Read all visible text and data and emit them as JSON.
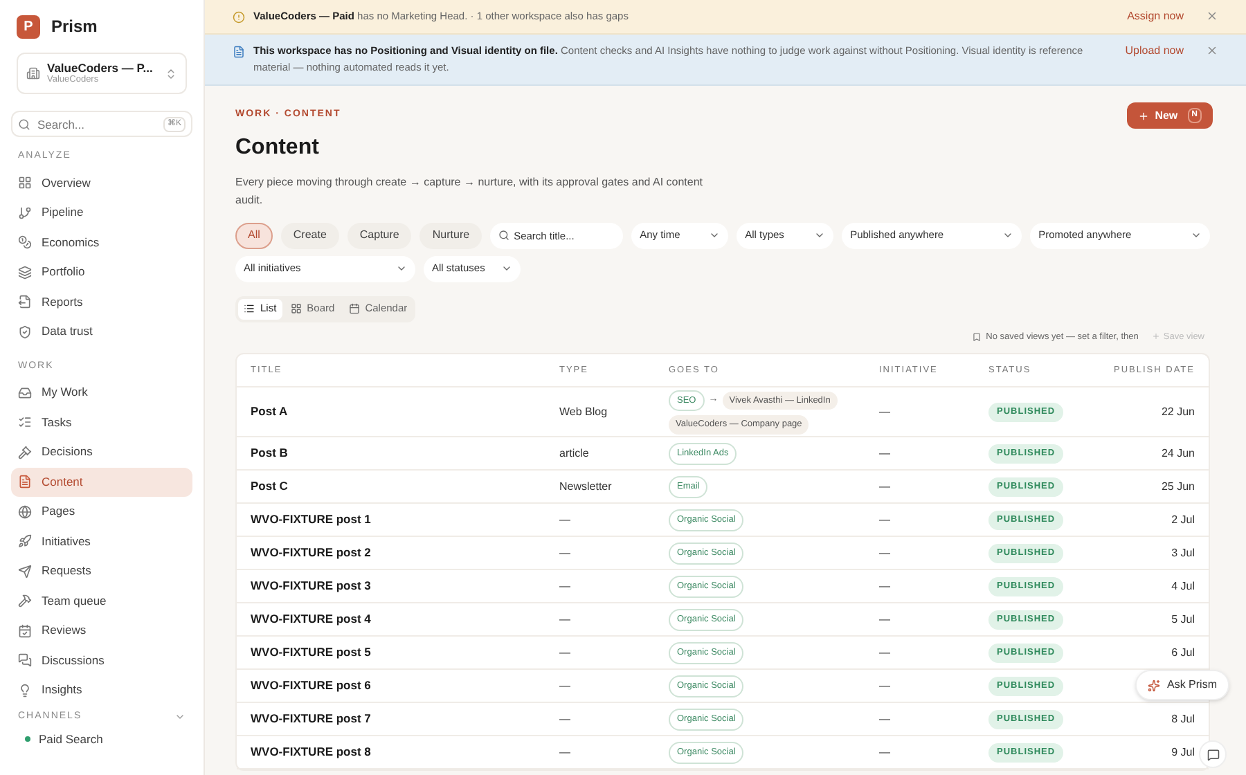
{
  "app": {
    "name": "Prism",
    "logo_letter": "P"
  },
  "workspace": {
    "name": "ValueCoders — P...",
    "sub": "ValueCoders"
  },
  "search": {
    "placeholder": "Search...",
    "shortcut": "⌘K"
  },
  "sections": [
    {
      "title": "ANALYZE",
      "items": [
        {
          "label": "Overview",
          "selected": false
        },
        {
          "label": "Pipeline",
          "selected": false
        },
        {
          "label": "Economics",
          "selected": false
        },
        {
          "label": "Portfolio",
          "selected": false
        },
        {
          "label": "Reports",
          "selected": false
        },
        {
          "label": "Data trust",
          "selected": false
        }
      ]
    },
    {
      "title": "WORK",
      "items": [
        {
          "label": "My Work",
          "selected": false
        },
        {
          "label": "Tasks",
          "selected": false
        },
        {
          "label": "Decisions",
          "selected": false
        },
        {
          "label": "Content",
          "selected": true
        },
        {
          "label": "Pages",
          "selected": false
        },
        {
          "label": "Initiatives",
          "selected": false
        },
        {
          "label": "Requests",
          "selected": false
        },
        {
          "label": "Team queue",
          "selected": false
        },
        {
          "label": "Reviews",
          "selected": false
        },
        {
          "label": "Discussions",
          "selected": false
        },
        {
          "label": "Insights",
          "selected": false
        }
      ]
    }
  ],
  "channels": {
    "title": "CHANNELS",
    "items": [
      {
        "label": "Paid Search",
        "color": "#2f9e6e"
      }
    ]
  },
  "banners": [
    {
      "kind": "warning",
      "text": "**ValueCoders — Paid** has no Marketing Head. · 1 other workspace also has gaps",
      "action": "Assign now"
    },
    {
      "kind": "info",
      "text": "**This workspace has no Positioning and Visual identity on file.** Content checks and AI Insights have nothing to judge work against without Positioning. Visual identity is reference material — nothing automated reads it yet.",
      "action": "Upload now"
    }
  ],
  "breadcrumb": "WORK · CONTENT",
  "title": "Content",
  "description": "Every piece moving through create → capture → nurture, with its approval gates and AI content audit.",
  "new_button": {
    "label": "New",
    "shortcut": "N"
  },
  "stage_filters": [
    {
      "label": "All",
      "selected": true
    },
    {
      "label": "Create",
      "selected": false
    },
    {
      "label": "Capture",
      "selected": false
    },
    {
      "label": "Nurture",
      "selected": false
    }
  ],
  "title_search": {
    "placeholder": "Search title..."
  },
  "dropdowns": [
    {
      "label": "Any time"
    },
    {
      "label": "All types"
    },
    {
      "label": "Published anywhere"
    },
    {
      "label": "Promoted anywhere"
    },
    {
      "label": "All initiatives"
    },
    {
      "label": "All statuses"
    }
  ],
  "views": [
    {
      "label": "List",
      "selected": true
    },
    {
      "label": "Board",
      "selected": false
    },
    {
      "label": "Calendar",
      "selected": false
    }
  ],
  "saved_views": {
    "text": "No saved views yet — set a filter, then",
    "action": "Save view"
  },
  "table": {
    "columns": [
      "TITLE",
      "TYPE",
      "GOES TO",
      "INITIATIVE",
      "STATUS",
      "PUBLISH DATE"
    ],
    "rows": [
      {
        "title": "Post A",
        "type": "Web Blog",
        "goes_to": [
          {
            "kind": "channel",
            "text": "SEO"
          },
          {
            "kind": "arrow",
            "text": "→"
          },
          {
            "kind": "target",
            "text": "Vivek Avasthi — LinkedIn"
          },
          {
            "kind": "target",
            "text": "ValueCoders — Company page"
          }
        ],
        "initiative": "—",
        "status": "PUBLISHED",
        "date": "22 Jun"
      },
      {
        "title": "Post B",
        "type": "article",
        "goes_to": [
          {
            "kind": "channel",
            "text": "LinkedIn Ads"
          }
        ],
        "initiative": "—",
        "status": "PUBLISHED",
        "date": "24 Jun"
      },
      {
        "title": "Post C",
        "type": "Newsletter",
        "goes_to": [
          {
            "kind": "channel",
            "text": "Email"
          }
        ],
        "initiative": "—",
        "status": "PUBLISHED",
        "date": "25 Jun"
      },
      {
        "title": "WVO-FIXTURE post 1",
        "type": "—",
        "goes_to": [
          {
            "kind": "channel",
            "text": "Organic Social"
          }
        ],
        "initiative": "—",
        "status": "PUBLISHED",
        "date": "2 Jul"
      },
      {
        "title": "WVO-FIXTURE post 2",
        "type": "—",
        "goes_to": [
          {
            "kind": "channel",
            "text": "Organic Social"
          }
        ],
        "initiative": "—",
        "status": "PUBLISHED",
        "date": "3 Jul"
      },
      {
        "title": "WVO-FIXTURE post 3",
        "type": "—",
        "goes_to": [
          {
            "kind": "channel",
            "text": "Organic Social"
          }
        ],
        "initiative": "—",
        "status": "PUBLISHED",
        "date": "4 Jul"
      },
      {
        "title": "WVO-FIXTURE post 4",
        "type": "—",
        "goes_to": [
          {
            "kind": "channel",
            "text": "Organic Social"
          }
        ],
        "initiative": "—",
        "status": "PUBLISHED",
        "date": "5 Jul"
      },
      {
        "title": "WVO-FIXTURE post 5",
        "type": "—",
        "goes_to": [
          {
            "kind": "channel",
            "text": "Organic Social"
          }
        ],
        "initiative": "—",
        "status": "PUBLISHED",
        "date": "6 Jul"
      },
      {
        "title": "WVO-FIXTURE post 6",
        "type": "—",
        "goes_to": [
          {
            "kind": "channel",
            "text": "Organic Social"
          }
        ],
        "initiative": "—",
        "status": "PUBLISHED"
      },
      {
        "title": "WVO-FIXTURE post 7",
        "type": "—",
        "goes_to": [
          {
            "kind": "channel",
            "text": "Organic Social"
          }
        ],
        "initiative": "—",
        "status": "PUBLISHED",
        "date": "8 Jul"
      },
      {
        "title": "WVO-FIXTURE post 8",
        "type": "—",
        "goes_to": [
          {
            "kind": "channel",
            "text": "Organic Social"
          }
        ],
        "initiative": "—",
        "status": "PUBLISHED",
        "date": "9 Jul"
      }
    ]
  },
  "assistant": {
    "label": "Ask Prism"
  }
}
